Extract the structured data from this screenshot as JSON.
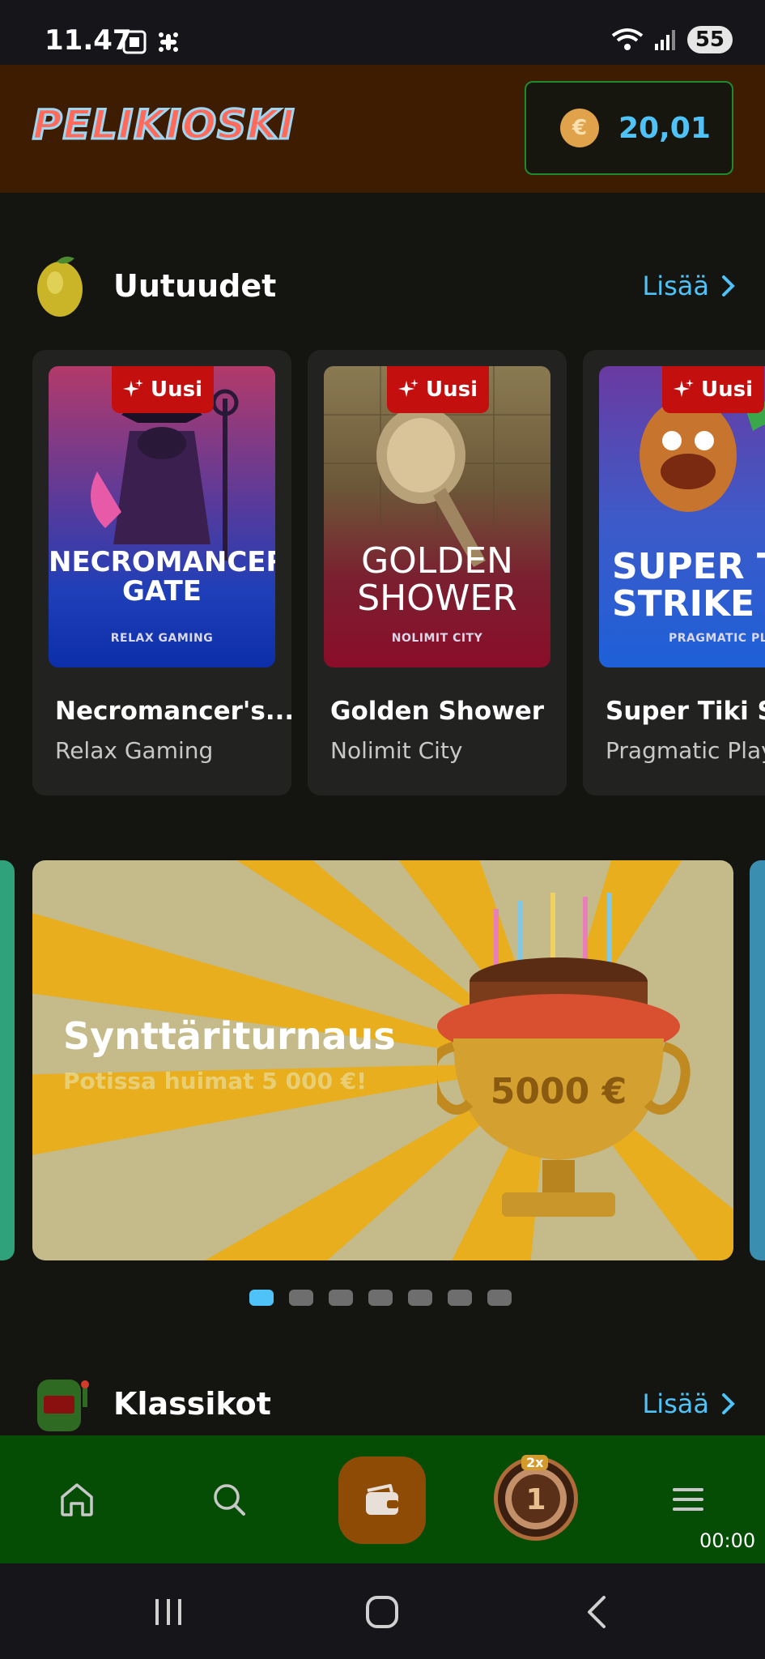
{
  "status_bar": {
    "time": "11.47",
    "battery": "55"
  },
  "header": {
    "logo": "PELIKIOSKI",
    "balance": "20,01",
    "currency_symbol": "€"
  },
  "section_new": {
    "title": "Uutuudet",
    "more_label": "Lisää"
  },
  "games": [
    {
      "name": "Necromancer's...",
      "provider": "Relax Gaming",
      "badge": "Uusi",
      "art_title": "NECROMANCER'S GATE",
      "art_provider": "RELAX GAMING"
    },
    {
      "name": "Golden Shower",
      "provider": "Nolimit City",
      "badge": "Uusi",
      "art_title": "GOLDEN SHOWER",
      "art_provider": "NOLIMIT CITY"
    },
    {
      "name": "Super Tiki St",
      "provider": "Pragmatic Play",
      "badge": "Uusi",
      "art_title": "SUPER TI STRIKE",
      "art_provider": "PRAGMATIC PLAY"
    }
  ],
  "banner": {
    "title": "Synttäriturnaus",
    "subtitle": "Potissa huimat 5 000 €!",
    "trophy_label": "5000 €"
  },
  "carousel": {
    "active_index": 0,
    "count": 7
  },
  "section_classics": {
    "title": "Klassikot",
    "more_label": "Lisää"
  },
  "bottom_nav": {
    "token_multiplier": "2x",
    "timer": "00:00"
  },
  "colors": {
    "accent": "#4fc3f7",
    "header_bg": "#3d1c02",
    "nav_bg": "#054d05",
    "badge": "#c40f0f"
  }
}
